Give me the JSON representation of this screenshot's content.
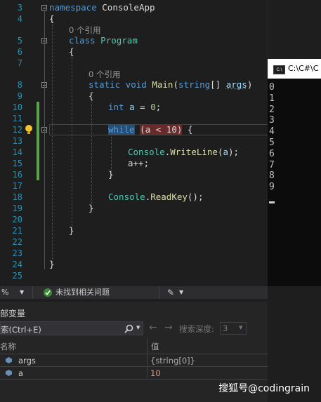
{
  "editor": {
    "line_numbers": [
      "3",
      "4",
      "5",
      "6",
      "7",
      "8",
      "9",
      "10",
      "11",
      "12",
      "13",
      "14",
      "15",
      "16",
      "17",
      "18",
      "19",
      "20",
      "21",
      "22",
      "23",
      "24",
      "25"
    ],
    "refs_label": "0 个引用",
    "kw_namespace": "namespace",
    "ns_name": "ConsoleApp",
    "kw_class": "class",
    "class_name": "Program",
    "kw_static": "static",
    "kw_void": "void",
    "method_name": "Main",
    "kw_string": "string",
    "param_name": "args",
    "kw_int": "int",
    "var_a": "a",
    "num_zero": "0",
    "kw_while": "while",
    "while_cond": "(a < 10)",
    "type_console": "Console",
    "method_writeline": "WriteLine",
    "method_readkey": "ReadKey",
    "open_brace": "{",
    "close_brace": "}",
    "a_incr": "a++;"
  },
  "console": {
    "title": "C:\\C#\\C",
    "icon_text": "C:\\",
    "output": [
      "0",
      "1",
      "2",
      "3",
      "4",
      "5",
      "6",
      "7",
      "8",
      "9"
    ]
  },
  "statusbar": {
    "zoom": "%",
    "issues": "未找到相关问题"
  },
  "locals": {
    "title": "部变量",
    "search_placeholder": "索(Ctrl+E)",
    "search_depth_label": "搜索深度:",
    "search_depth_value": "3",
    "col_name": "名称",
    "col_value": "值",
    "rows": [
      {
        "name": "args",
        "value": "{string[0]}"
      },
      {
        "name": "a",
        "value": "10"
      }
    ]
  },
  "watermark": "搜狐号@codingrain",
  "colors": {
    "keyword": "#569cd6",
    "type": "#4ec9b0",
    "method": "#dcdcaa",
    "line_number": "#2b91af",
    "changed_value": "#d69d85"
  }
}
